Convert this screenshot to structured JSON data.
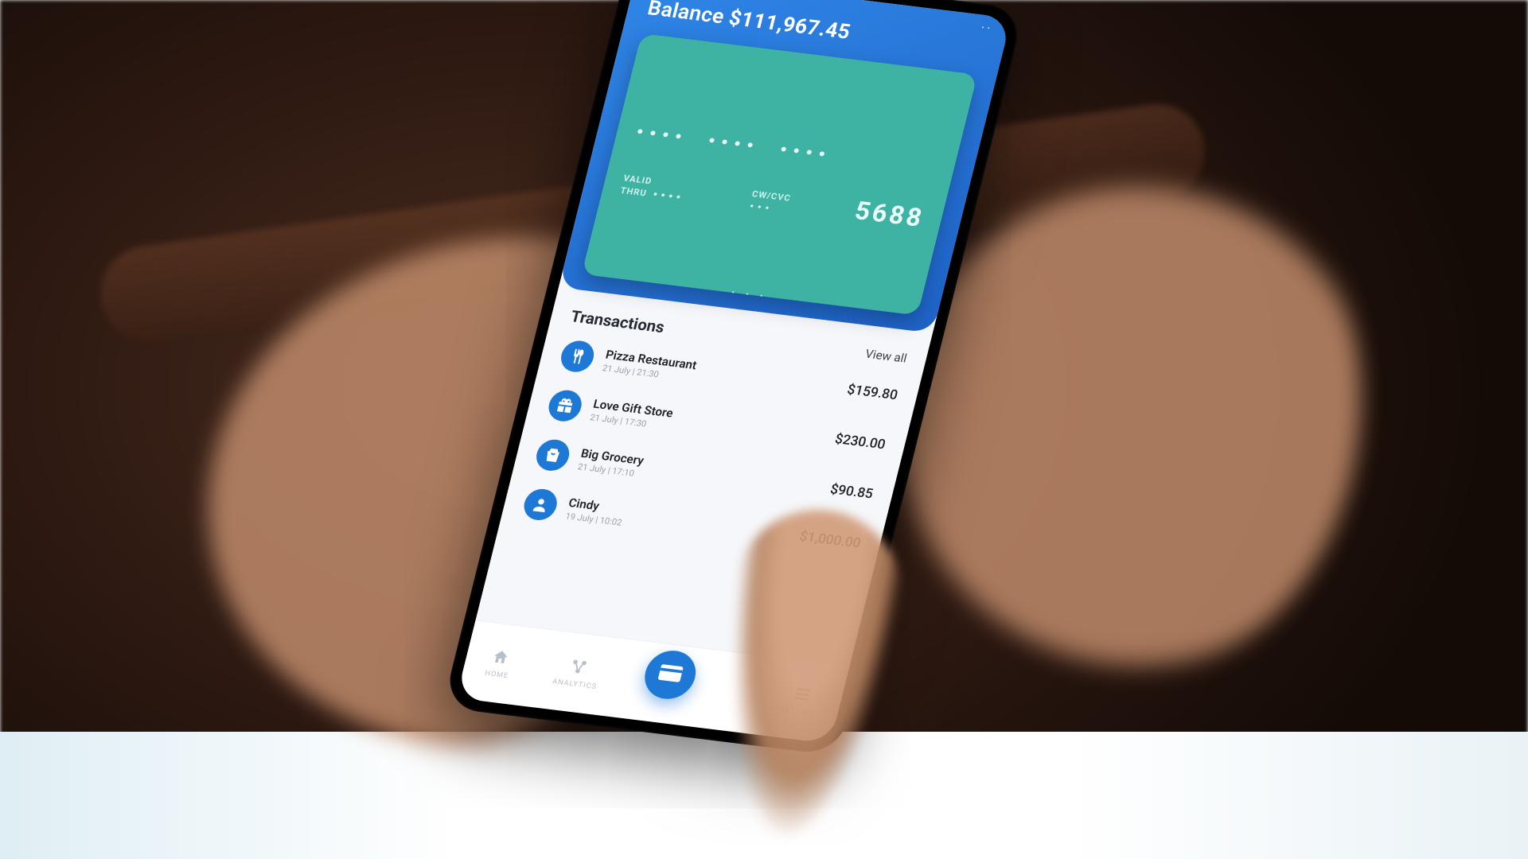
{
  "header": {
    "balance_label": "Balance",
    "balance_value": "$111,967.45"
  },
  "card": {
    "num1": "••••",
    "num2": "••••",
    "num3": "••••",
    "valid_label": "VALID",
    "thru_label": "THRU",
    "thru_value": "••••",
    "cvv_label": "CW/CVC",
    "cvv_value": "•••",
    "last4": "5688",
    "pager": "•  •  •"
  },
  "transactions": {
    "title": "Transactions",
    "view_all": "View all",
    "items": [
      {
        "icon": "food",
        "name": "Pizza Restaurant",
        "sub": "21 July  |  21:30",
        "amount": "$159.80"
      },
      {
        "icon": "gift",
        "name": "Love Gift Store",
        "sub": "21 July  |  17:30",
        "amount": "$230.00"
      },
      {
        "icon": "bag",
        "name": "Big Grocery",
        "sub": "21 July  |  17:10",
        "amount": "$90.85"
      },
      {
        "icon": "person",
        "name": "Cindy",
        "sub": "19 July  |  10:02",
        "amount": "$1,000.00"
      }
    ]
  },
  "nav": {
    "home": "HOME",
    "analytics": "ANALYTICS",
    "setting": "SETTING"
  }
}
